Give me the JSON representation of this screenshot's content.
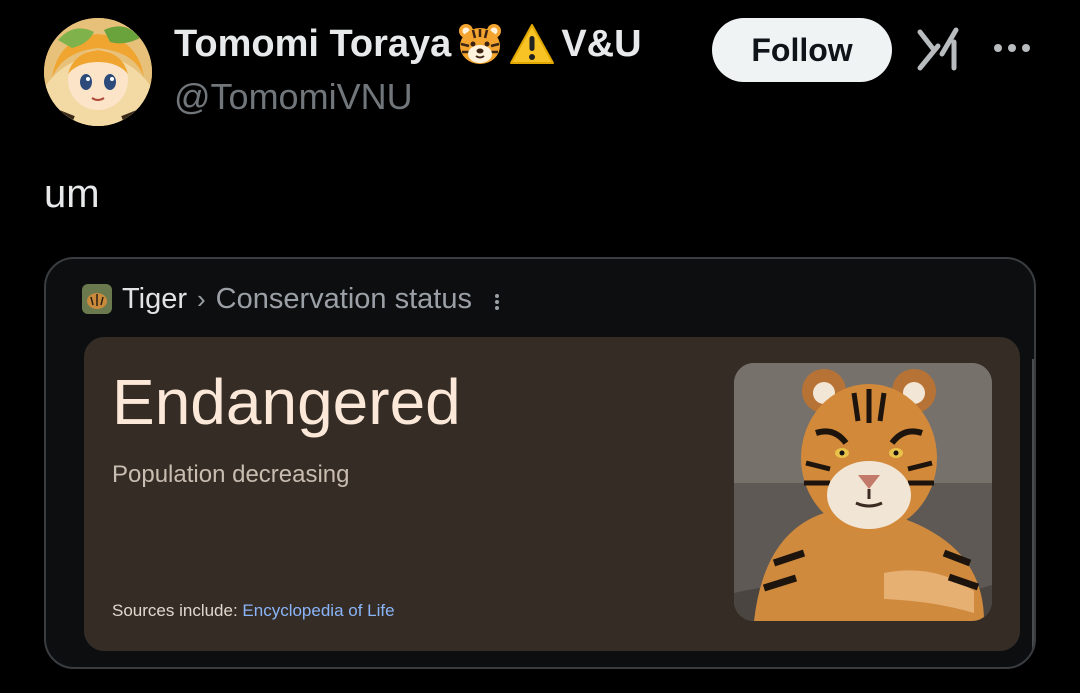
{
  "author": {
    "display_name": "Tomomi Toraya",
    "name_suffix": "V&U",
    "handle": "@TomomiVNU"
  },
  "header": {
    "follow_label": "Follow",
    "icons": [
      "grok-icon",
      "more-icon"
    ]
  },
  "post": {
    "text": "um"
  },
  "card": {
    "breadcrumb_main": "Tiger",
    "breadcrumb_separator": "›",
    "breadcrumb_sub": "Conservation status",
    "status": "Endangered",
    "trend": "Population decreasing",
    "sources_label": "Sources include: ",
    "sources_link": "Encyclopedia of Life"
  },
  "colors": {
    "background": "#000000",
    "follow_bg": "#eff3f4",
    "panel_bg": "#352d25",
    "link": "#8ab4f8",
    "handle": "#71767b"
  }
}
